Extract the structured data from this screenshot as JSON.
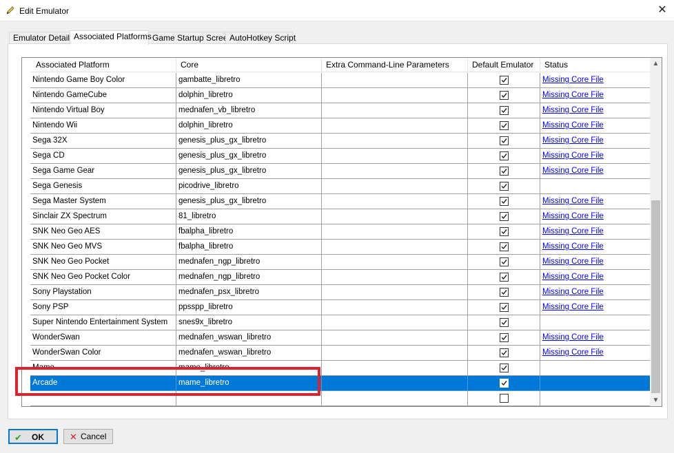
{
  "window": {
    "title": "Edit Emulator"
  },
  "tabs": [
    {
      "label": "Emulator Details"
    },
    {
      "label": "Associated Platforms"
    },
    {
      "label": "Game Startup Screen"
    },
    {
      "label": "AutoHotkey Script"
    }
  ],
  "table": {
    "headers": [
      "Associated Platform",
      "Core",
      "Extra Command-Line Parameters",
      "Default Emulator",
      "Status"
    ],
    "rows": [
      {
        "platform": "Nintendo Game Boy Color",
        "core": "gambatte_libretro",
        "params": "",
        "default": true,
        "status": "Missing Core File"
      },
      {
        "platform": "Nintendo GameCube",
        "core": "dolphin_libretro",
        "params": "",
        "default": true,
        "status": "Missing Core File"
      },
      {
        "platform": "Nintendo Virtual Boy",
        "core": "mednafen_vb_libretro",
        "params": "",
        "default": true,
        "status": "Missing Core File"
      },
      {
        "platform": "Nintendo Wii",
        "core": "dolphin_libretro",
        "params": "",
        "default": true,
        "status": "Missing Core File"
      },
      {
        "platform": "Sega 32X",
        "core": "genesis_plus_gx_libretro",
        "params": "",
        "default": true,
        "status": "Missing Core File"
      },
      {
        "platform": "Sega CD",
        "core": "genesis_plus_gx_libretro",
        "params": "",
        "default": true,
        "status": "Missing Core File"
      },
      {
        "platform": "Sega Game Gear",
        "core": "genesis_plus_gx_libretro",
        "params": "",
        "default": true,
        "status": "Missing Core File"
      },
      {
        "platform": "Sega Genesis",
        "core": "picodrive_libretro",
        "params": "",
        "default": true,
        "status": ""
      },
      {
        "platform": "Sega Master System",
        "core": "genesis_plus_gx_libretro",
        "params": "",
        "default": true,
        "status": "Missing Core File"
      },
      {
        "platform": "Sinclair ZX Spectrum",
        "core": "81_libretro",
        "params": "",
        "default": true,
        "status": "Missing Core File"
      },
      {
        "platform": "SNK Neo Geo AES",
        "core": "fbalpha_libretro",
        "params": "",
        "default": true,
        "status": "Missing Core File"
      },
      {
        "platform": "SNK Neo Geo MVS",
        "core": "fbalpha_libretro",
        "params": "",
        "default": true,
        "status": "Missing Core File"
      },
      {
        "platform": "SNK Neo Geo Pocket",
        "core": "mednafen_ngp_libretro",
        "params": "",
        "default": true,
        "status": "Missing Core File"
      },
      {
        "platform": "SNK Neo Geo Pocket Color",
        "core": "mednafen_ngp_libretro",
        "params": "",
        "default": true,
        "status": "Missing Core File"
      },
      {
        "platform": "Sony Playstation",
        "core": "mednafen_psx_libretro",
        "params": "",
        "default": true,
        "status": "Missing Core File"
      },
      {
        "platform": "Sony PSP",
        "core": "ppsspp_libretro",
        "params": "",
        "default": true,
        "status": "Missing Core File"
      },
      {
        "platform": "Super Nintendo Entertainment System",
        "core": "snes9x_libretro",
        "params": "",
        "default": true,
        "status": ""
      },
      {
        "platform": "WonderSwan",
        "core": "mednafen_wswan_libretro",
        "params": "",
        "default": true,
        "status": "Missing Core File"
      },
      {
        "platform": "WonderSwan Color",
        "core": "mednafen_wswan_libretro",
        "params": "",
        "default": true,
        "status": "Missing Core File"
      },
      {
        "platform": "Mame",
        "core": "mame_libretro",
        "params": "",
        "default": true,
        "status": ""
      },
      {
        "platform": "Arcade",
        "core": "mame_libretro",
        "params": "",
        "default": true,
        "status": "",
        "selected": true
      },
      {
        "platform": "",
        "core": "",
        "params": "",
        "default": false,
        "status": ""
      }
    ]
  },
  "buttons": {
    "ok": "OK",
    "cancel": "Cancel"
  },
  "colors": {
    "selection": "#0078d7",
    "highlight_box": "#e0202a",
    "link": "#0000ee"
  }
}
